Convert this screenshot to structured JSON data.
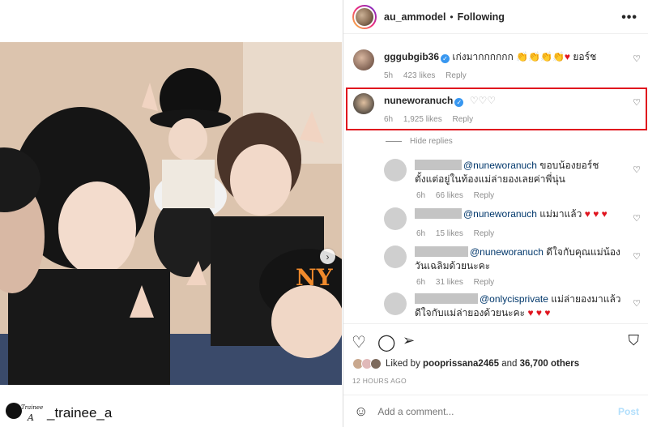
{
  "watermark": {
    "logo_text_top": "Trainee",
    "logo_text_letter": "A",
    "handle": "_trainee_a"
  },
  "header": {
    "username": "au_ammodel",
    "separator": "•",
    "follow_state": "Following",
    "more_glyph": "•••"
  },
  "comments": [
    {
      "username": "gggubgib36",
      "verified": true,
      "text": "เก่งมากกกกกก",
      "emoji": "👏👏👏👏",
      "heart": "♥",
      "suffix": " ยอร์ช",
      "time": "5h",
      "likes": "423 likes",
      "reply": "Reply"
    },
    {
      "username": "nuneworanuch",
      "verified": true,
      "text": "♡♡♡",
      "time": "6h",
      "likes": "1,925 likes",
      "reply": "Reply",
      "highlighted": true
    }
  ],
  "hide_replies": "Hide replies",
  "replies": [
    {
      "mention": "@nuneworanuch",
      "text": "ขอบน้องยอร์ชตั้งแต่อยู่ในท้องแม่ล่ายองเลยค่าพี่นุ่น",
      "time": "6h",
      "likes": "66 likes",
      "reply": "Reply"
    },
    {
      "mention": "@nuneworanuch",
      "text": "แม่มาแล้ว",
      "hearts": "♥ ♥ ♥",
      "time": "6h",
      "likes": "15 likes",
      "reply": "Reply"
    },
    {
      "mention": "@nuneworanuch",
      "text": "ดีใจกับคุณแม่น้องวันเฉลิมด้วยนะคะ",
      "time": "6h",
      "likes": "31 likes",
      "reply": "Reply"
    },
    {
      "mention": "@onlycisprivate",
      "text": "แม่ล่ายองมาแล้วดีใจกับแม่ล่ายองด้วยนะคะ",
      "hearts": "♥ ♥ ♥",
      "time": "",
      "likes": "",
      "reply": ""
    }
  ],
  "likes": {
    "prefix": "Liked by",
    "user": "pooprissana2465",
    "and": "and",
    "count": "36,700 others"
  },
  "time_ago": "12 HOURS AGO",
  "add_comment": {
    "placeholder": "Add a comment...",
    "post_label": "Post"
  },
  "colors": {
    "highlight": "#e0141e",
    "link": "#00376b",
    "verified": "#3897f0",
    "post_disabled": "#b2dffc"
  },
  "icons": [
    "heart-icon",
    "comment-icon",
    "share-icon",
    "bookmark-icon",
    "smile-icon",
    "chevron-right-icon",
    "more-icon",
    "verified-icon"
  ]
}
